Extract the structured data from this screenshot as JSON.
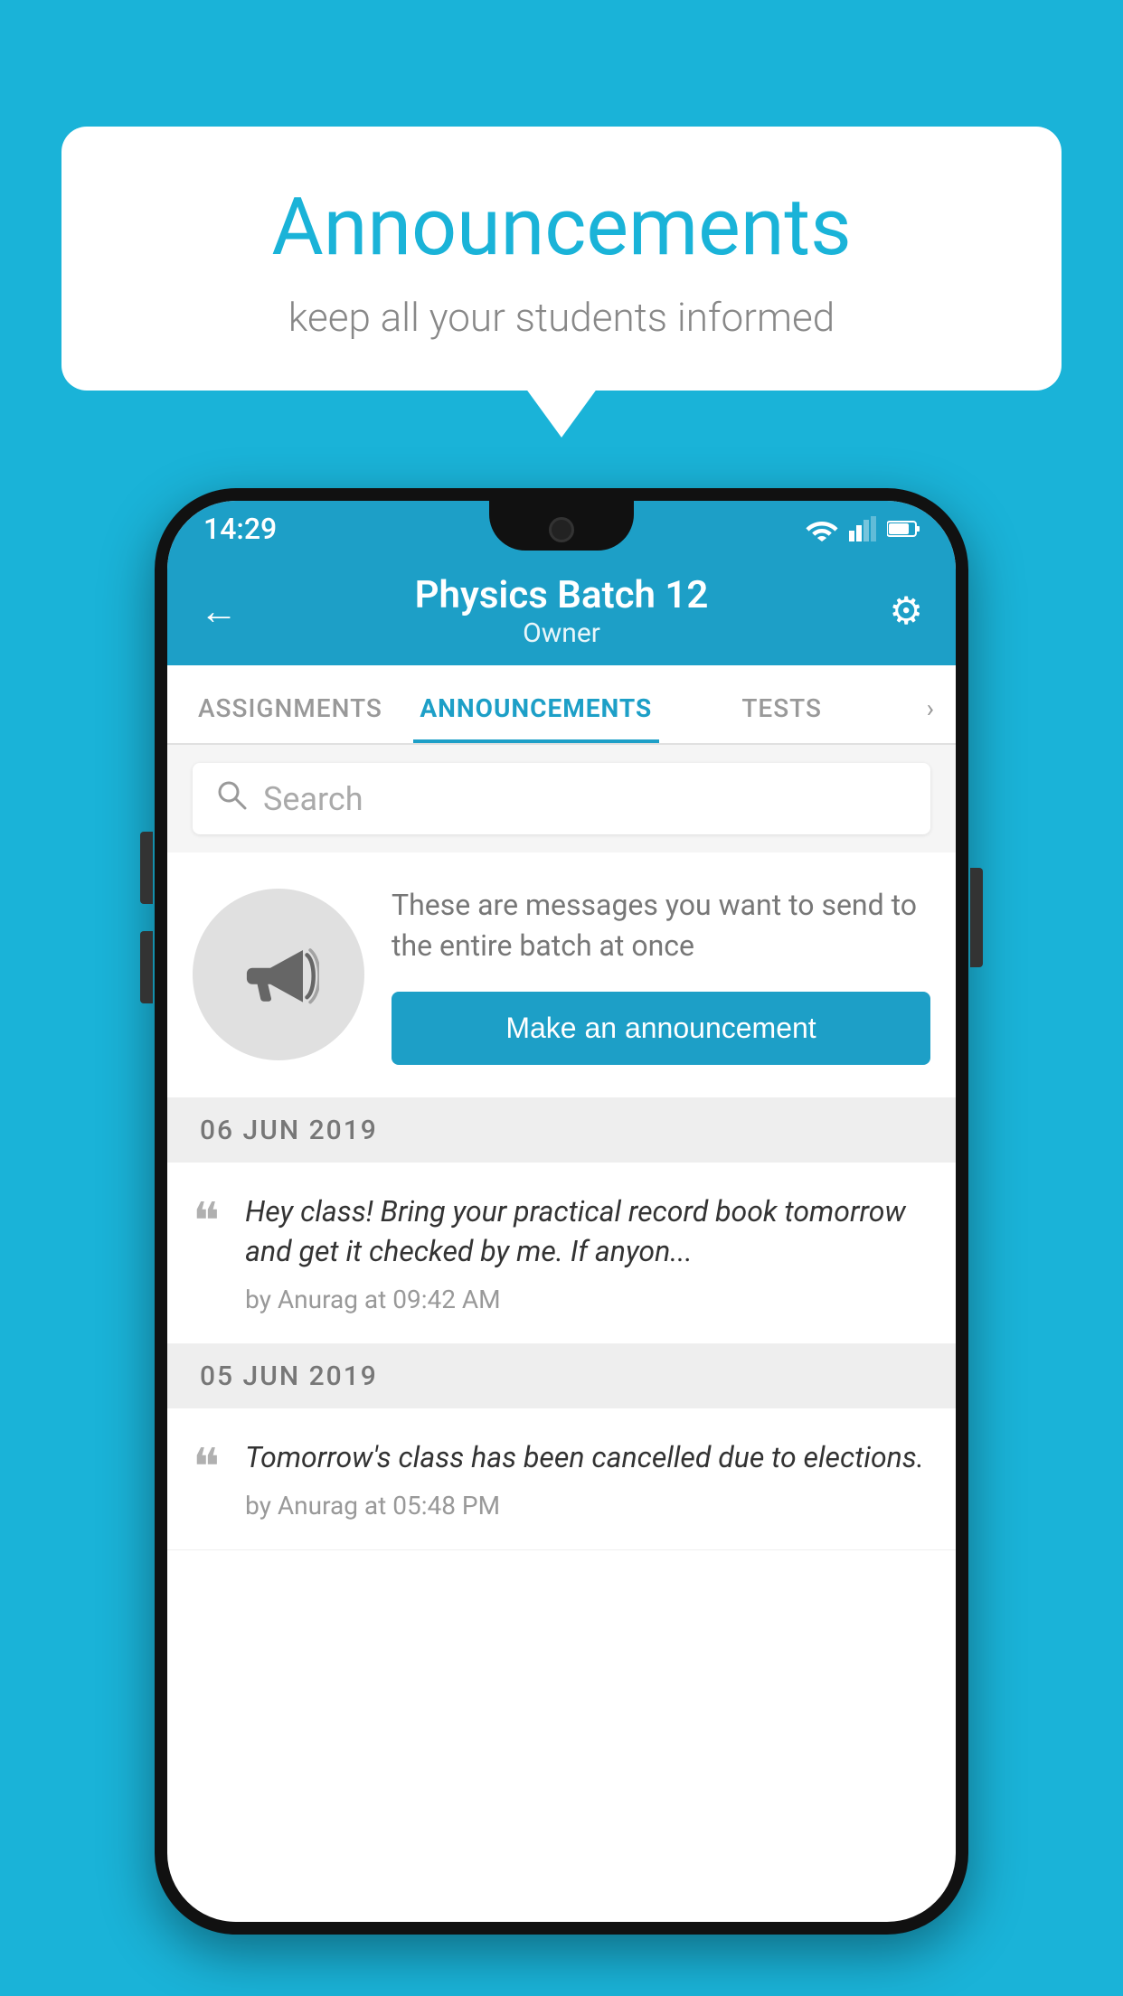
{
  "background_color": "#1ab3d8",
  "speech_bubble": {
    "title": "Announcements",
    "subtitle": "keep all your students informed"
  },
  "phone": {
    "status_bar": {
      "time": "14:29"
    },
    "top_bar": {
      "class_name": "Physics Batch 12",
      "class_role": "Owner",
      "back_label": "←",
      "settings_label": "⚙"
    },
    "tabs": [
      {
        "label": "ASSIGNMENTS",
        "active": false
      },
      {
        "label": "ANNOUNCEMENTS",
        "active": true
      },
      {
        "label": "TESTS",
        "active": false
      },
      {
        "label": "›",
        "active": false
      }
    ],
    "search": {
      "placeholder": "Search"
    },
    "announcement_card": {
      "description": "These are messages you want to send to the entire batch at once",
      "button_label": "Make an announcement"
    },
    "messages": [
      {
        "date": "06  JUN  2019",
        "text": "Hey class! Bring your practical record book tomorrow and get it checked by me. If anyon...",
        "meta": "by Anurag at 09:42 AM"
      },
      {
        "date": "05  JUN  2019",
        "text": "Tomorrow's class has been cancelled due to elections.",
        "meta": "by Anurag at 05:48 PM"
      }
    ]
  }
}
